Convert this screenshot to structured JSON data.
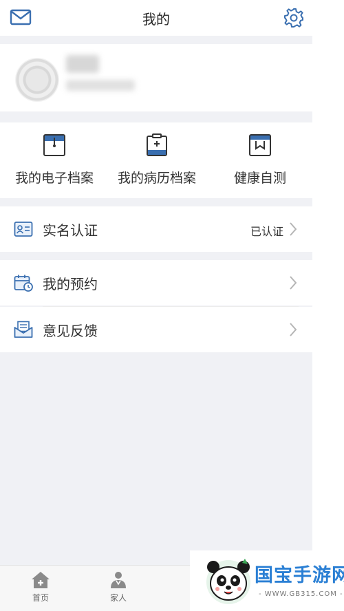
{
  "header": {
    "title": "我的"
  },
  "quick_actions": [
    {
      "label": "我的电子档案",
      "icon": "archive-icon"
    },
    {
      "label": "我的病历档案",
      "icon": "medical-record-icon"
    },
    {
      "label": "健康自测",
      "icon": "health-test-icon"
    }
  ],
  "verification": {
    "label": "实名认证",
    "status": "已认证",
    "icon": "id-card-icon"
  },
  "menu": [
    {
      "label": "我的预约",
      "icon": "calendar-clock-icon"
    },
    {
      "label": "意见反馈",
      "icon": "feedback-mail-icon"
    }
  ],
  "tabbar": [
    {
      "label": "首页",
      "icon": "home-plus-icon"
    },
    {
      "label": "家人",
      "icon": "family-doctor-icon"
    },
    {
      "label": "",
      "icon": "partial-icon"
    }
  ],
  "watermark": {
    "text": "国宝手游网",
    "url": "- WWW.GB315.COM -"
  },
  "colors": {
    "accent": "#3a6fb0",
    "background": "#f0f1f5",
    "watermark": "#2a7fd4"
  }
}
